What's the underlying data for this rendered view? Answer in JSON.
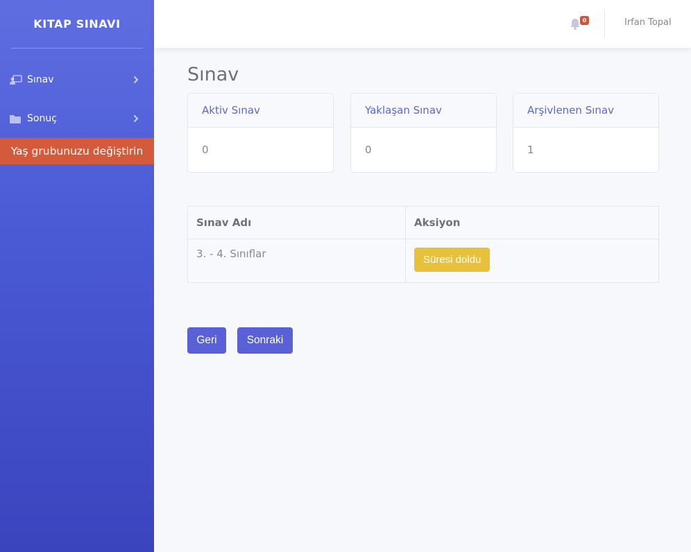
{
  "sidebar": {
    "brand": "KITAP SINAVI",
    "items": [
      {
        "label": "Sınav",
        "icon": "chalkboard-teacher-icon"
      },
      {
        "label": "Sonuç",
        "icon": "folder-icon"
      }
    ],
    "age_group_button": "Yaş grubunuzu değiştirin",
    "accent": "#d45a3c"
  },
  "topbar": {
    "notification_count": "0",
    "user_name": "Irfan Topal"
  },
  "main": {
    "title": "Sınav",
    "cards": [
      {
        "label": "Aktiv Sınav",
        "value": "0"
      },
      {
        "label": "Yaklaşan Sınav",
        "value": "0"
      },
      {
        "label": "Arşivlenen Sınav",
        "value": "1"
      }
    ],
    "table": {
      "headers": [
        "Sınav Adı",
        "Aksiyon"
      ],
      "rows": [
        {
          "name": "3. - 4. Sınıflar",
          "action": "Süresi doldu"
        }
      ]
    },
    "pagination": {
      "prev": "Geri",
      "next": "Sonraki"
    }
  }
}
